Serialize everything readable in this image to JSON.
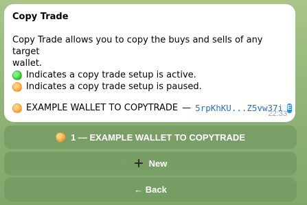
{
  "message": {
    "title": "Copy Trade",
    "desc_line1": "Copy Trade allows you to copy the buys and sells of any target",
    "desc_line2": "wallet.",
    "active_text": "Indicates a copy trade setup is active.",
    "paused_text": "Indicates a copy trade setup is paused.",
    "wallet_label": "EXAMPLE WALLET TO COPYTRADE",
    "wallet_sep": "—",
    "wallet_address": "5rpKhKU...Z5vw37i",
    "wallet_badge": "E",
    "time": "22:33"
  },
  "buttons": {
    "wallet_button": "1 — EXAMPLE WALLET TO COPYTRADE",
    "new_button": "New",
    "back_button": "← Back"
  },
  "colors": {
    "green_status": "#2bbf2a",
    "orange_status": "#ff9b2f",
    "link_mono": "#2b6fb8"
  },
  "icons": {
    "active": "green-circle-icon",
    "paused": "orange-circle-icon",
    "wallet": "orange-circle-icon",
    "new": "plus-icon",
    "address_badge": "e-badge-icon"
  }
}
